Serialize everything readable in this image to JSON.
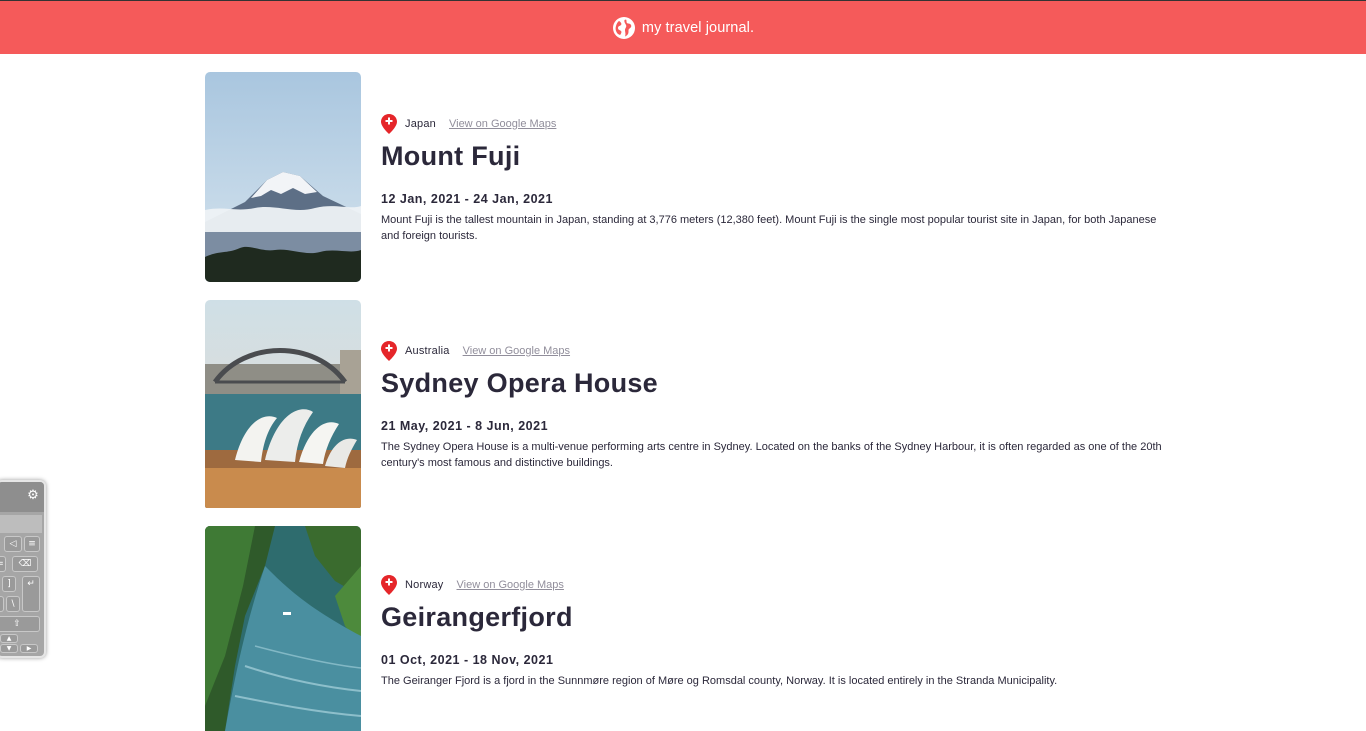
{
  "header": {
    "title": "my travel journal.",
    "icon": "globe-icon",
    "background": "#f55a5a"
  },
  "entries": [
    {
      "country": "Japan",
      "maps_link": "View on Google Maps",
      "title": "Mount Fuji",
      "dates": "12 Jan, 2021 - 24 Jan, 2021",
      "description": "Mount Fuji is the tallest mountain in Japan, standing at 3,776 meters (12,380 feet). Mount Fuji is the single most popular tourist site in Japan, for both Japanese and foreign tourists."
    },
    {
      "country": "Australia",
      "maps_link": "View on Google Maps",
      "title": "Sydney Opera House",
      "dates": "21 May, 2021 - 8 Jun, 2021",
      "description": "The Sydney Opera House is a multi-venue performing arts centre in Sydney. Located on the banks of the Sydney Harbour, it is often regarded as one of the 20th century's most famous and distinctive buildings."
    },
    {
      "country": "Norway",
      "maps_link": "View on Google Maps",
      "title": "Geirangerfjord",
      "dates": "01 Oct, 2021 - 18 Nov, 2021",
      "description": "The Geiranger Fjord is a fjord in the Sunnmøre region of Møre og Romsdal county, Norway. It is located entirely in the Stranda Municipality."
    }
  ],
  "keyboard_widget": {
    "icons": [
      "gear-icon",
      "backspace-icon",
      "enter-icon",
      "shift-icon",
      "arrow-up-icon",
      "arrow-down-icon",
      "arrow-right-icon"
    ],
    "keys": [
      "]",
      "\\"
    ]
  },
  "colors": {
    "accent": "#f55a5a",
    "pin": "#e5262a",
    "text": "#2b283a",
    "link": "#918e9b"
  }
}
